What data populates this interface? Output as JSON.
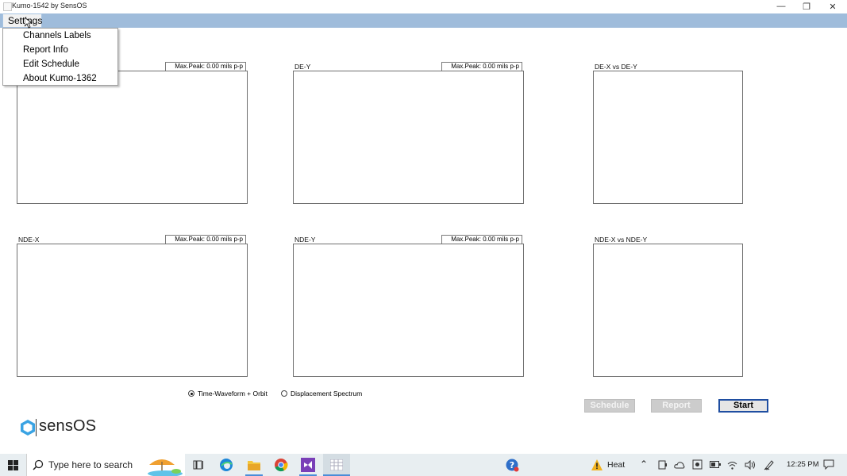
{
  "window": {
    "title": "Kumo-1542 by SensOS",
    "minimize": "—",
    "restore": "❐",
    "close": "✕"
  },
  "menu": {
    "settings_label": "Settings",
    "items": [
      "Channels Labels",
      "Report Info",
      "Edit Schedule",
      "About Kumo-1362"
    ]
  },
  "panels": {
    "dex": {
      "peak": "Max.Peak: 0.00 mils p-p"
    },
    "dey": {
      "label": "DE-Y",
      "peak": "Max.Peak: 0.00 mils p-p"
    },
    "orbit_de": {
      "label": "DE-X vs DE-Y"
    },
    "ndex": {
      "label": "NDE-X",
      "peak": "Max.Peak: 0.00 mils p-p"
    },
    "ndey": {
      "label": "NDE-Y",
      "peak": "Max.Peak: 0.00 mils p-p"
    },
    "orbit_nde": {
      "label": "NDE-X vs NDE-Y"
    }
  },
  "view_mode": {
    "options": [
      "Time-Waveform + Orbit",
      "Displacement Spectrum"
    ],
    "selected": "Time-Waveform + Orbit"
  },
  "buttons": {
    "schedule": "Schedule",
    "report": "Report",
    "start": "Start"
  },
  "logo": {
    "text": "sensOS"
  },
  "taskbar": {
    "search_placeholder": "Type here to search",
    "weather": "Heat",
    "time": "12:25 PM"
  },
  "colors": {
    "menubar": "#9fbcdb",
    "start_border": "#1f4ea1",
    "disabled_button": "#cccccc",
    "taskbar": "#e8eef1"
  }
}
